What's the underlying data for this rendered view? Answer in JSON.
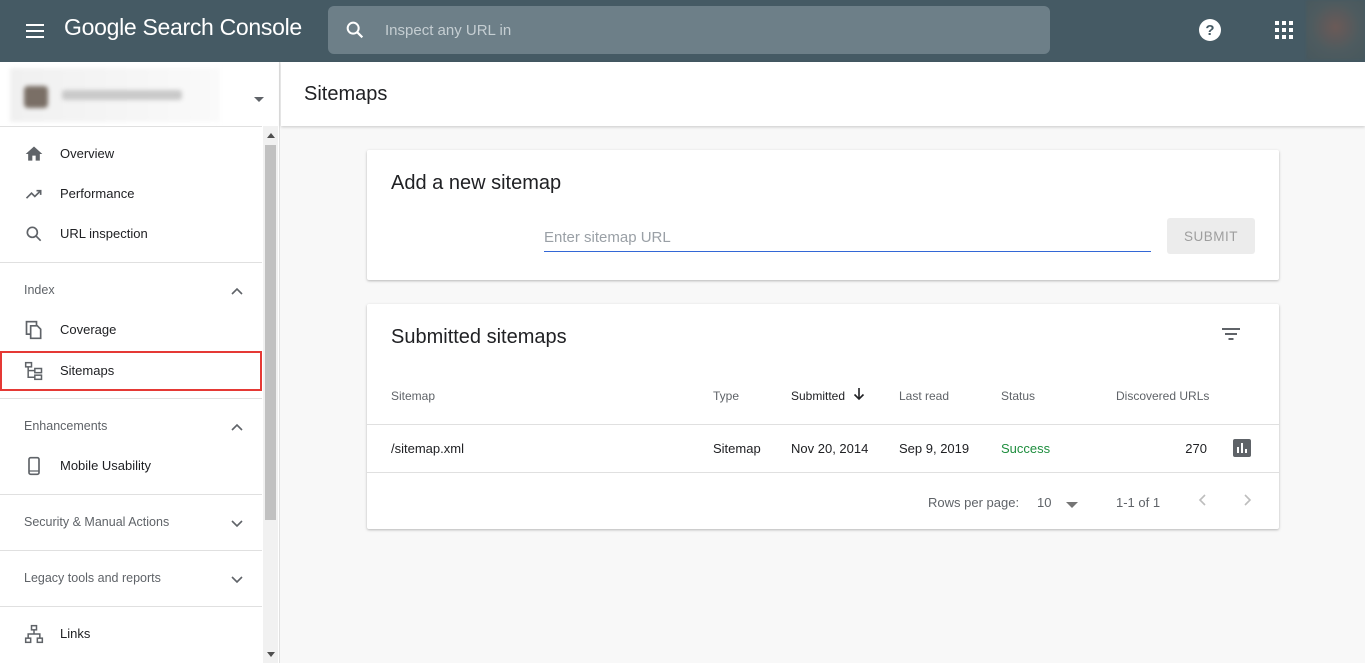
{
  "header": {
    "brand": "Google Search Console",
    "search_placeholder": "Inspect any URL in"
  },
  "sidebar": {
    "items_top": [
      {
        "label": "Overview",
        "icon": "home-icon"
      },
      {
        "label": "Performance",
        "icon": "trending-up-icon"
      },
      {
        "label": "URL inspection",
        "icon": "search-icon"
      }
    ],
    "sections": {
      "index": "Index",
      "enhancements": "Enhancements",
      "security": "Security & Manual Actions",
      "legacy": "Legacy tools and reports"
    },
    "index_items": [
      {
        "label": "Coverage",
        "icon": "file-copy-icon"
      },
      {
        "label": "Sitemaps",
        "icon": "sitemap-icon",
        "selected": true
      }
    ],
    "enhancement_items": [
      {
        "label": "Mobile Usability",
        "icon": "smartphone-icon"
      }
    ],
    "bottom_items": [
      {
        "label": "Links",
        "icon": "links-icon"
      }
    ]
  },
  "main": {
    "page_title": "Sitemaps",
    "add_card": {
      "title": "Add a new sitemap",
      "input_placeholder": "Enter sitemap URL",
      "submit_label": "SUBMIT"
    },
    "list_card": {
      "title": "Submitted sitemaps",
      "columns": [
        "Sitemap",
        "Type",
        "Submitted",
        "Last read",
        "Status",
        "Discovered URLs"
      ],
      "sorted_column": "Submitted",
      "rows": [
        {
          "sitemap": "/sitemap.xml",
          "type": "Sitemap",
          "submitted": "Nov 20, 2014",
          "last_read": "Sep 9, 2019",
          "status": "Success",
          "discovered_urls": "270"
        }
      ],
      "footer": {
        "rows_per_page_label": "Rows per page:",
        "rows_per_page_value": "10",
        "range": "1-1 of 1"
      }
    }
  },
  "colors": {
    "topbar": "#455a64",
    "success": "#1e8e3e",
    "selected_outline": "#e53935",
    "input_underline": "#3367d6"
  }
}
